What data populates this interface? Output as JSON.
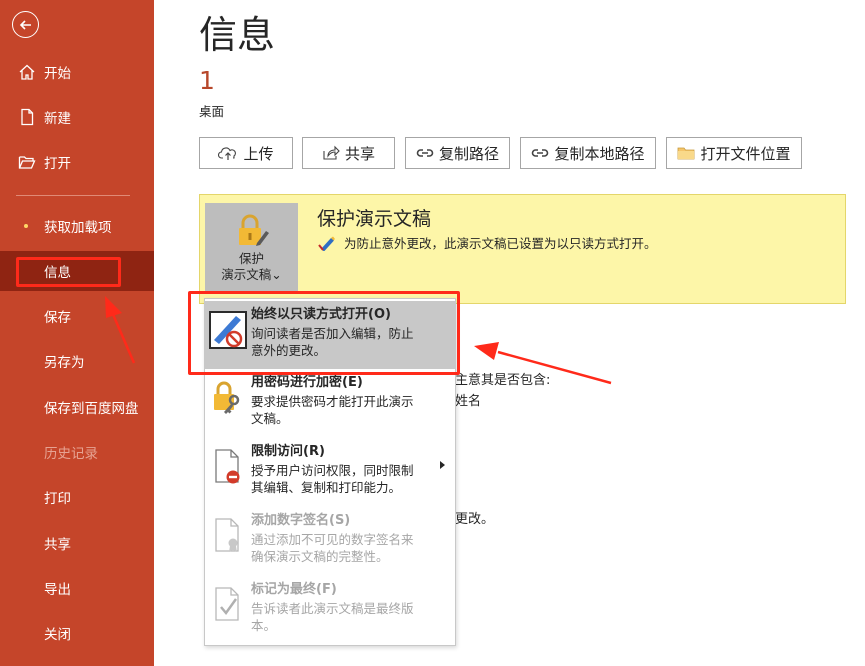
{
  "sidebar": {
    "items": [
      {
        "label": "开始",
        "icon": "home-icon"
      },
      {
        "label": "新建",
        "icon": "new-document-icon"
      },
      {
        "label": "打开",
        "icon": "open-folder-icon"
      },
      {
        "label": "获取加载项"
      },
      {
        "label": "信息",
        "active": true
      },
      {
        "label": "保存"
      },
      {
        "label": "另存为"
      },
      {
        "label": "保存到百度网盘"
      },
      {
        "label": "历史记录",
        "disabled": true
      },
      {
        "label": "打印"
      },
      {
        "label": "共享"
      },
      {
        "label": "导出"
      },
      {
        "label": "关闭"
      }
    ]
  },
  "main": {
    "title": "信息",
    "count": "1",
    "location": "桌面",
    "buttons": [
      {
        "label": "上传",
        "icon": "upload-icon"
      },
      {
        "label": "共享",
        "icon": "share-icon"
      },
      {
        "label": "复制路径",
        "icon": "link-icon"
      },
      {
        "label": "复制本地路径",
        "icon": "link-icon"
      },
      {
        "label": "打开文件位置",
        "icon": "folder-icon"
      }
    ],
    "protect": {
      "button_line1": "保护",
      "button_line2": "演示文稿",
      "caret": "⌄",
      "title": "保护演示文稿",
      "description": "为防止意外更改，此演示文稿已设置为以只读方式打开。"
    },
    "background_fragments": [
      "主意其是否包含:",
      "姓名",
      "更改。"
    ]
  },
  "menu": {
    "items": [
      {
        "title": "始终以只读方式打开(O)",
        "desc1": "询问读者是否加入编辑，防止",
        "desc2": "意外的更改。",
        "icon": "read-only-icon",
        "highlight": true
      },
      {
        "title": "用密码进行加密(E)",
        "desc1": "要求提供密码才能打开此演示",
        "desc2": "文稿。",
        "icon": "lock-key-icon"
      },
      {
        "title": "限制访问(R)",
        "desc1": "授予用户访问权限，同时限制",
        "desc2": "其编辑、复制和打印能力。",
        "icon": "restrict-access-icon",
        "submenu": true
      },
      {
        "title": "添加数字签名(S)",
        "desc1": "通过添加不可见的数字签名来",
        "desc2": "确保演示文稿的完整性。",
        "icon": "certificate-icon",
        "disabled": true
      },
      {
        "title": "标记为最终(F)",
        "desc1": "告诉读者此演示文稿是最终版",
        "desc2": "本。",
        "icon": "mark-final-icon",
        "disabled": true
      }
    ]
  },
  "colors": {
    "sidebar": "#c5452a",
    "sidebar_active": "#8f2412",
    "protect_panel": "#fdf6a8",
    "annotation": "#ff2a1a"
  }
}
